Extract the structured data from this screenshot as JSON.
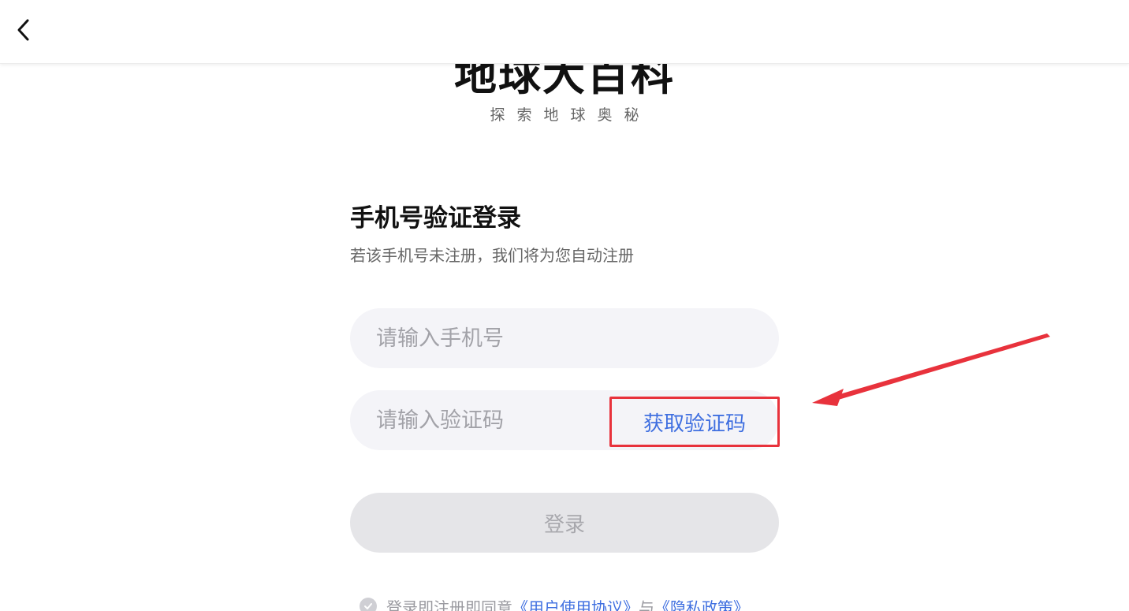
{
  "header": {
    "back_icon": "chevron-left-icon"
  },
  "logo": {
    "title": "地球大百科",
    "subtitle": "探索地球奥秘"
  },
  "login_form": {
    "title": "手机号验证登录",
    "subtitle": "若该手机号未注册，我们将为您自动注册",
    "phone_placeholder": "请输入手机号",
    "code_placeholder": "请输入验证码",
    "get_code_label": "获取验证码",
    "login_label": "登录"
  },
  "agreement": {
    "prefix": "登录即注册即同意",
    "user_agreement": "《用户使用协议》",
    "joiner": "与",
    "privacy_policy": "《隐私政策》"
  },
  "colors": {
    "accent_blue": "#3f6fe0",
    "annotation_red": "#e8323c",
    "field_bg": "#f4f4f8",
    "login_disabled_bg": "#e5e5e8"
  }
}
